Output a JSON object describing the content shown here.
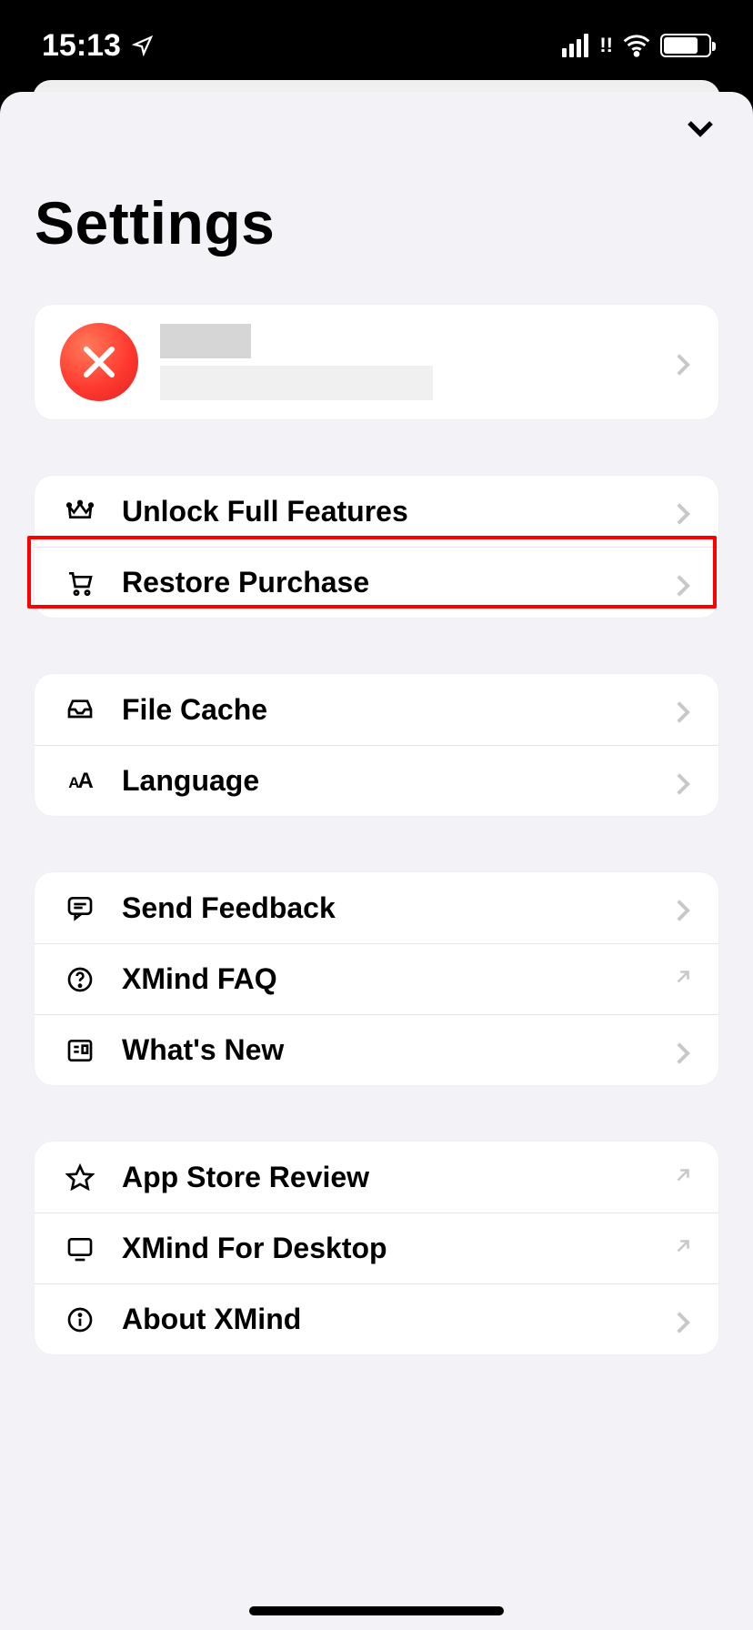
{
  "status": {
    "time": "15:13"
  },
  "page": {
    "title": "Settings"
  },
  "rows": {
    "unlock": "Unlock Full Features",
    "restore": "Restore Purchase",
    "filecache": "File Cache",
    "language": "Language",
    "feedback": "Send Feedback",
    "faq": "XMind FAQ",
    "whatsnew": "What's New",
    "review": "App Store Review",
    "desktop": "XMind For Desktop",
    "about": "About XMind"
  }
}
